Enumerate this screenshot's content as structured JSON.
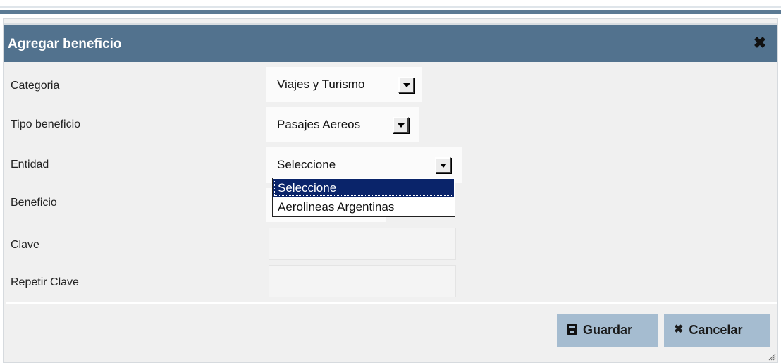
{
  "dialog": {
    "title": "Agregar beneficio",
    "close_icon": "close-icon"
  },
  "form": {
    "categoria": {
      "label": "Categoria",
      "value": "Viajes y Turismo"
    },
    "tipo_beneficio": {
      "label": "Tipo beneficio",
      "value": "Pasajes Aereos"
    },
    "entidad": {
      "label": "Entidad",
      "value": "Seleccione",
      "options": [
        "Seleccione",
        "Aerolineas Argentinas"
      ]
    },
    "beneficio": {
      "label": "Beneficio"
    },
    "clave": {
      "label": "Clave",
      "value": ""
    },
    "repetir_clave": {
      "label": "Repetir Clave",
      "value": ""
    }
  },
  "buttons": {
    "guardar": {
      "label": "Guardar",
      "icon": "save-icon"
    },
    "cancelar": {
      "label": "Cancelar",
      "icon": "close-icon"
    }
  },
  "colors": {
    "titlebar": "#52728e",
    "button": "#a5bcd0",
    "selected_option": "#0a246a"
  }
}
